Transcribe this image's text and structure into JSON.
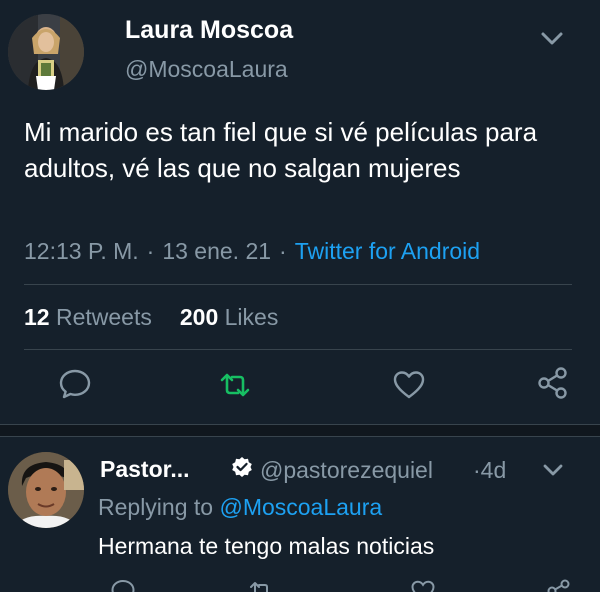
{
  "tweet": {
    "author_name": "Laura Moscoa",
    "author_handle": "@MoscoaLaura",
    "text": "Mi marido es tan fiel que si vé películas para adultos, vé las que no salgan mujeres",
    "time": "12:13 P. M.",
    "separator": "·",
    "date": "13 ene. 21",
    "source": "Twitter for Android",
    "retweets_count": "12",
    "retweets_label": "Retweets",
    "likes_count": "200",
    "likes_label": "Likes"
  },
  "reply": {
    "author_name": "Pastor...",
    "author_handle": "@pastorezequiel",
    "age": "·4d",
    "replying_prefix": "Replying to",
    "replying_to": "@MoscoaLaura",
    "text": "Hermana te tengo malas noticias"
  },
  "icons": {
    "more": "chevron-down-icon",
    "reply": "comment-icon",
    "retweet": "retweet-icon",
    "like": "heart-icon",
    "share": "share-icon",
    "verified": "verified-badge-icon"
  },
  "colors": {
    "background": "#15202b",
    "primary_text": "#ffffff",
    "secondary_text": "#8899a6",
    "link": "#1da1f2",
    "retweet_active": "#17bf63",
    "divider": "#38444d"
  }
}
